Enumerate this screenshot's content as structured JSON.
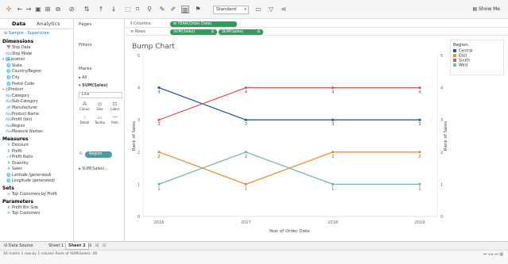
{
  "toolbar": {
    "fit_select": "Standard",
    "show_me": "Show Me"
  },
  "left_pane": {
    "tab_data": "Data",
    "tab_analytics": "Analytics",
    "datasource": "Sample - Superstore",
    "fields": [
      {
        "kind": "section",
        "label": "Dimensions"
      },
      {
        "kind": "dim",
        "icon": "📅",
        "label": "Ship Date"
      },
      {
        "kind": "dim",
        "icon": "Abc",
        "label": "Ship Mode"
      },
      {
        "kind": "dim",
        "icon": "▾ 🌐",
        "label": "Location"
      },
      {
        "kind": "dim",
        "icon": "🌐",
        "label": "State"
      },
      {
        "kind": "dim",
        "icon": "🌐",
        "label": "Country/Region"
      },
      {
        "kind": "dim",
        "icon": "🌐",
        "label": "City"
      },
      {
        "kind": "dim",
        "icon": "🌐",
        "label": "Postal Code"
      },
      {
        "kind": "dim",
        "icon": "▾ 品",
        "label": "Product"
      },
      {
        "kind": "dim",
        "icon": "Abc",
        "label": "Category"
      },
      {
        "kind": "dim",
        "icon": "Abc",
        "label": "Sub-Category"
      },
      {
        "kind": "dim",
        "icon": "🔗",
        "label": "Manufacturer"
      },
      {
        "kind": "dim",
        "icon": "Abc",
        "label": "Product Name"
      },
      {
        "kind": "dim",
        "icon": "Abc",
        "label": "Profit (bin)"
      },
      {
        "kind": "dim",
        "icon": "Abc",
        "label": "Region"
      },
      {
        "kind": "dim",
        "icon": "Abc",
        "label": "Measure Names",
        "italic": true
      },
      {
        "kind": "section",
        "label": "Measures"
      },
      {
        "kind": "mea",
        "icon": "#",
        "label": "Discount"
      },
      {
        "kind": "mea",
        "icon": "#",
        "label": "Profit"
      },
      {
        "kind": "mea",
        "icon": "=#",
        "label": "Profit Ratio"
      },
      {
        "kind": "mea",
        "icon": "#",
        "label": "Quantity"
      },
      {
        "kind": "mea",
        "icon": "#",
        "label": "Sales"
      },
      {
        "kind": "mea",
        "icon": "🌐",
        "label": "Latitude (generated)",
        "italic": true
      },
      {
        "kind": "mea",
        "icon": "🌐",
        "label": "Longitude (generated)",
        "italic": true
      },
      {
        "kind": "section",
        "label": "Sets"
      },
      {
        "kind": "dim",
        "icon": "◎",
        "label": "Top Customers by Profit"
      },
      {
        "kind": "section",
        "label": "Parameters"
      },
      {
        "kind": "mea",
        "icon": "#",
        "label": "Profit Bin Size"
      },
      {
        "kind": "mea",
        "icon": "#",
        "label": "Top Customers"
      }
    ]
  },
  "mid_pane": {
    "pages": "Pages",
    "filters": "Filters",
    "marks": "Marks",
    "all": "All",
    "sum_sales": "SUM(Sales)",
    "mark_type": "Line",
    "btn_color": "Colour",
    "btn_size": "Size",
    "btn_label": "Label",
    "btn_detail": "Detail",
    "btn_tooltip": "Tooltip",
    "btn_path": "Path",
    "region_pill": "Region",
    "sum_sales_2": "SUM(Sales)..."
  },
  "shelves": {
    "columns_label": "Columns",
    "rows_label": "Rows",
    "columns_pill": "YEAR(Order Date)",
    "rows_pill_1": "SUM(Sales)",
    "rows_pill_2": "SUM(Sales)"
  },
  "legend": {
    "title": "Region",
    "items": [
      {
        "label": "Central",
        "color": "#1f5fa8"
      },
      {
        "label": "East",
        "color": "#f28e2b"
      },
      {
        "label": "South",
        "color": "#e15759"
      },
      {
        "label": "West",
        "color": "#76b7b2"
      }
    ]
  },
  "sheet_bar": {
    "data_source": "Data Source",
    "sheet1": "Sheet 1",
    "sheet2": "Sheet 2"
  },
  "status": {
    "text": "16 marks   1 row by 1 column   Rank of SUM(Sales): 40"
  },
  "chart_data": {
    "type": "line",
    "title": "Bump Chart",
    "xlabel": "Year of Order Date",
    "ylabel": "Rank of Sales",
    "ylabel_right": "Rank of Sales",
    "categories": [
      "2016",
      "2017",
      "2018",
      "2019"
    ],
    "yticks": [
      0,
      1,
      2,
      3,
      4,
      5
    ],
    "ylim": [
      0,
      5
    ],
    "series": [
      {
        "name": "Central",
        "color": "#1f5fa8",
        "values": [
          4,
          3,
          3,
          3
        ]
      },
      {
        "name": "East",
        "color": "#f28e2b",
        "values": [
          2,
          1,
          2,
          2
        ]
      },
      {
        "name": "South",
        "color": "#e15759",
        "values": [
          3,
          4,
          4,
          4
        ]
      },
      {
        "name": "West",
        "color": "#76b7b2",
        "values": [
          1,
          2,
          1,
          1
        ]
      }
    ]
  }
}
